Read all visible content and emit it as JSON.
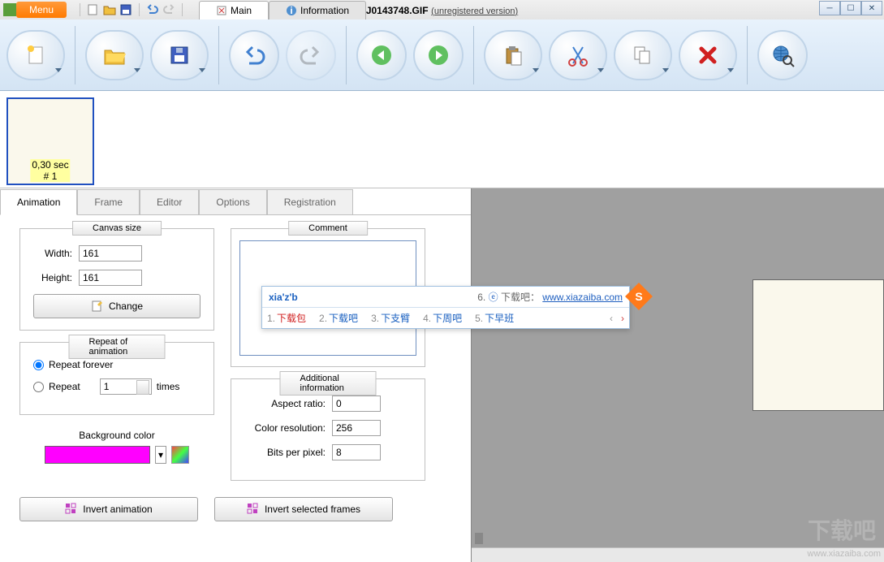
{
  "menubar": {
    "menu_btn": "Menu",
    "tabs": {
      "main": "Main",
      "info": "Information"
    },
    "title": "J0143748.GIF",
    "subtitle": "(unregistered version)"
  },
  "framestrip": {
    "frame1": {
      "time": "0,30 sec",
      "index": "# 1"
    }
  },
  "tabs": {
    "animation": "Animation",
    "frame": "Frame",
    "editor": "Editor",
    "options": "Options",
    "registration": "Registration"
  },
  "canvas": {
    "legend": "Canvas size",
    "width_label": "Width:",
    "width_value": "161",
    "height_label": "Height:",
    "height_value": "161",
    "change_btn": "Change"
  },
  "repeat": {
    "legend": "Repeat of animation",
    "forever": "Repeat forever",
    "repeat": "Repeat",
    "times_value": "1",
    "times_label": "times"
  },
  "bgcolor": {
    "label": "Background color",
    "hex": "#ff00ff"
  },
  "comment": {
    "legend": "Comment",
    "text": ""
  },
  "addinfo": {
    "legend": "Additional information",
    "aspect_label": "Aspect ratio:",
    "aspect_value": "0",
    "colorres_label": "Color resolution:",
    "colorres_value": "256",
    "bpp_label": "Bits per pixel:",
    "bpp_value": "8"
  },
  "buttons": {
    "invert_anim": "Invert animation",
    "invert_sel": "Invert selected frames"
  },
  "ime": {
    "input": "xia'z'b",
    "hint_num": "6.",
    "hint_text": "下载吧：",
    "hint_url": "www.xiazaiba.com",
    "candidates": [
      {
        "n": "1.",
        "t": "下载包"
      },
      {
        "n": "2.",
        "t": "下载吧"
      },
      {
        "n": "3.",
        "t": "下支臂"
      },
      {
        "n": "4.",
        "t": "下周吧"
      },
      {
        "n": "5.",
        "t": "下早班"
      }
    ]
  },
  "watermark": {
    "url": "www.xiazaiba.com",
    "big": "下载吧"
  }
}
